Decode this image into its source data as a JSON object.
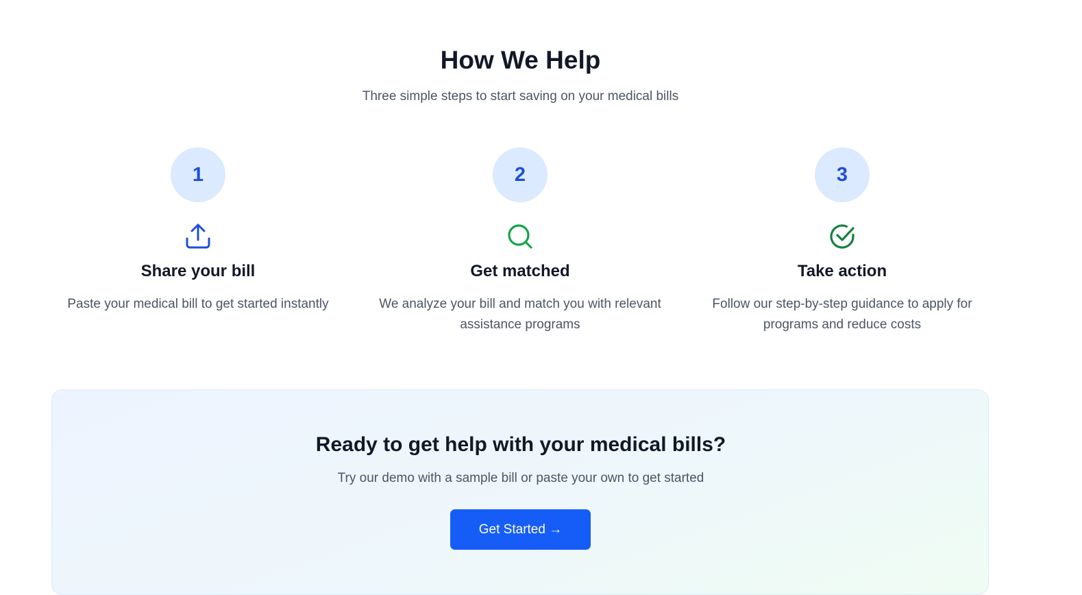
{
  "section": {
    "title": "How We Help",
    "subtitle": "Three simple steps to start saving on your medical bills"
  },
  "steps": [
    {
      "number": "1",
      "icon": "upload-icon",
      "icon_color": "#1d4ed8",
      "heading": "Share your bill",
      "text": "Paste your medical bill to get started instantly"
    },
    {
      "number": "2",
      "icon": "search-icon",
      "icon_color": "#16a34a",
      "heading": "Get matched",
      "text": "We analyze your bill and match you with relevant assistance programs"
    },
    {
      "number": "3",
      "icon": "check-circle-icon",
      "icon_color": "#15803d",
      "heading": "Take action",
      "text": "Follow our step-by-step guidance to apply for programs and reduce costs"
    }
  ],
  "cta": {
    "title": "Ready to get help with your medical bills?",
    "text": "Try our demo with a sample bill or paste your own to get started",
    "button_label": "Get Started →"
  },
  "colors": {
    "accent": "#165df7",
    "number_bg": "#dbeafe",
    "number_text": "#1d4ed8"
  }
}
